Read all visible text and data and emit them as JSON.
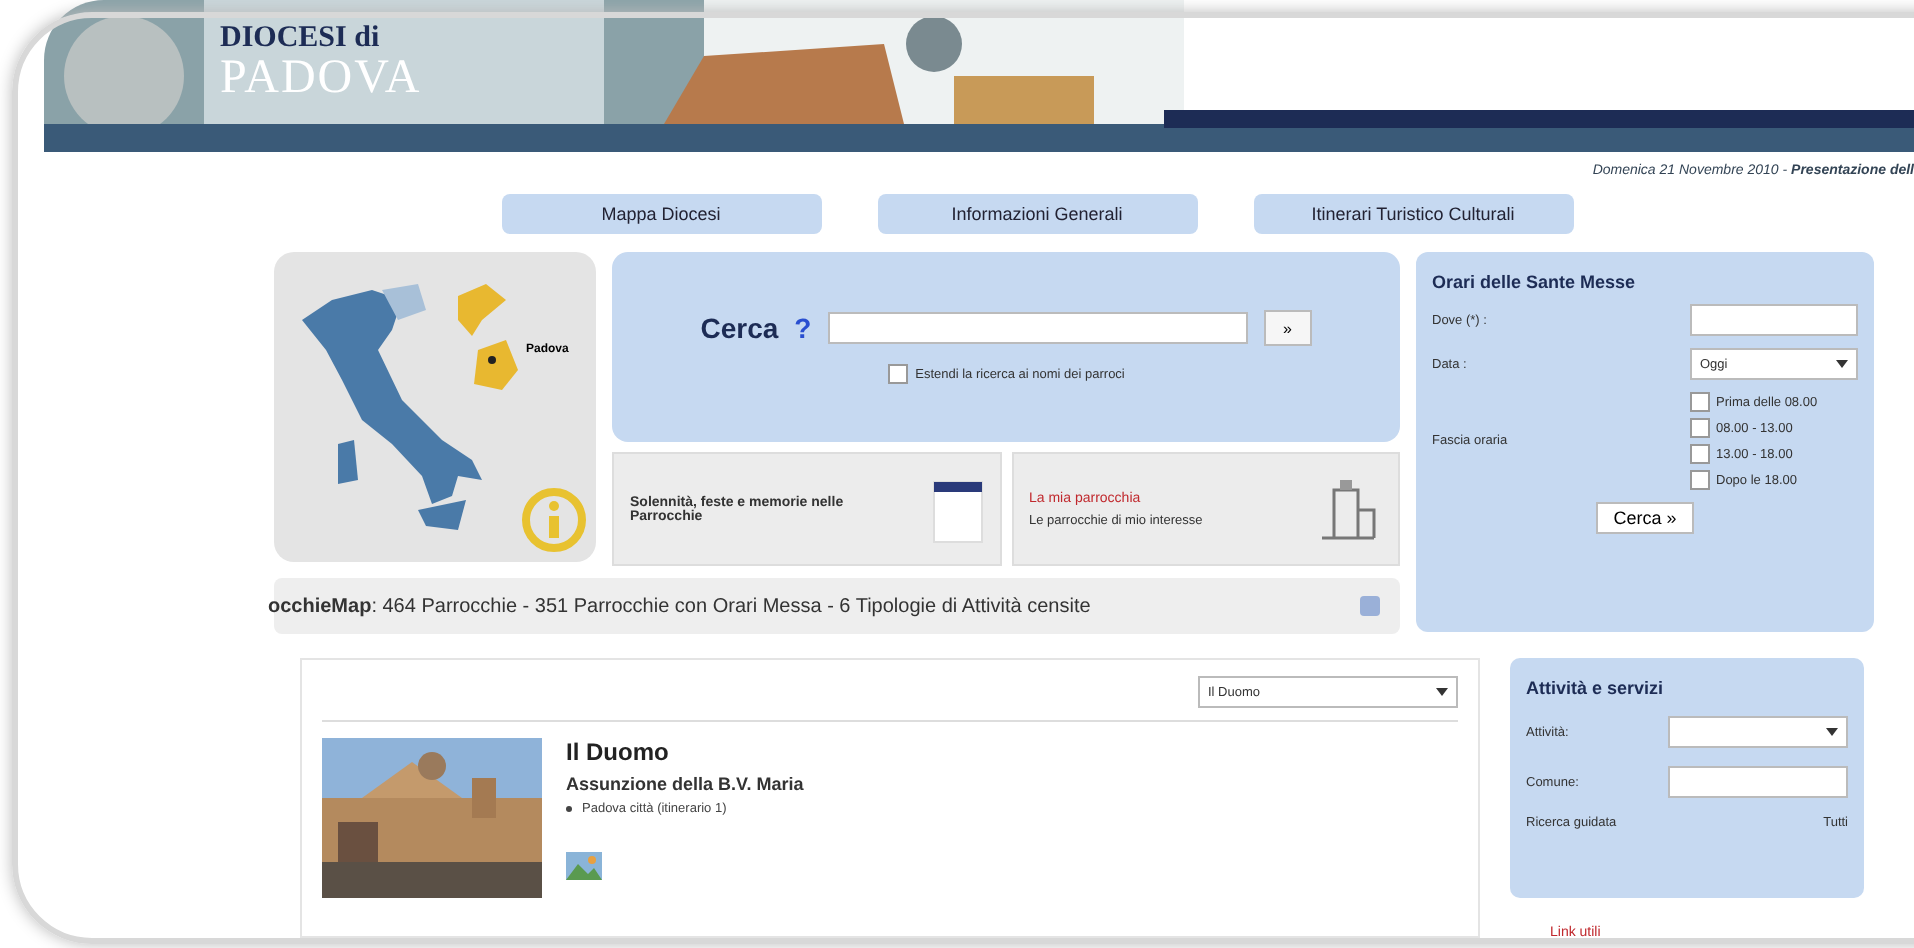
{
  "header": {
    "logo_top": "DIOCESI di",
    "logo_bottom": "PADOVA",
    "date_line": "Domenica 21 Novembre 2010 - **Presentazione dell**"
  },
  "nav": [
    {
      "label": "Mappa Diocesi"
    },
    {
      "label": "Informazioni Generali"
    },
    {
      "label": "Itinerari Turistico Culturali"
    }
  ],
  "map": {
    "label": "Padova"
  },
  "search": {
    "label": "Cerca",
    "help": "?",
    "button": "»",
    "extend": {
      "label": "Estendi la ricerca ai nomi dei parroci",
      "checked": false
    }
  },
  "cards": [
    {
      "kind": "calendar",
      "title": "Solennità, feste e memorie nelle Parrocchie"
    },
    {
      "kind": "parish",
      "title": "La mia parrocchia",
      "subtitle": "Le parrocchie di mio interesse"
    }
  ],
  "stats": "**occhieMap**: 464 Parrocchie - 351 Parrocchie con Orari Messa - 6 Tipologie di Attività censite",
  "masses": {
    "title": "Orari delle Sante Messe",
    "where_label": "Dove (*) :",
    "date_label": "Data :",
    "date_value": "Oggi",
    "slot_label": "Fascia oraria",
    "slots": [
      {
        "label": "Prima delle 08.00",
        "checked": false
      },
      {
        "label": "08.00 - 13.00",
        "checked": false
      },
      {
        "label": "13.00 - 18.00",
        "checked": false
      },
      {
        "label": "Dopo le 18.00",
        "checked": false
      }
    ],
    "button": "Cerca »"
  },
  "parish": {
    "select": "Il Duomo",
    "name": "Il Duomo",
    "dedication": "Assunzione della B.V. Maria",
    "place": "Padova città (itinerario 1)"
  },
  "activities": {
    "title": "Attività e servizi",
    "activity_label": "Attività:",
    "town_label": "Comune:",
    "guided": "Ricerca guidata",
    "all": "Tutti"
  },
  "links": "Link utili"
}
